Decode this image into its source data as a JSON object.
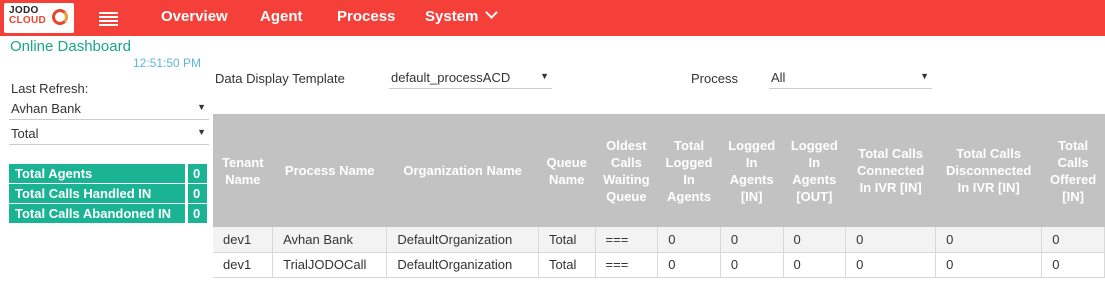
{
  "brand": {
    "line1": "JODO",
    "line2": "CLOUD"
  },
  "nav": {
    "overview": "Overview",
    "agent": "Agent",
    "process": "Process",
    "system": "System"
  },
  "dashboard": {
    "title": "Online Dashboard",
    "clock": "12:51:50 PM",
    "last_refresh_label": "Last Refresh:"
  },
  "left_filters": {
    "tenant": "Avhan Bank",
    "scope": "Total"
  },
  "summary": [
    {
      "label": "Total Agents",
      "value": "0"
    },
    {
      "label": "Total Calls Handled IN",
      "value": "0"
    },
    {
      "label": "Total Calls Abandoned IN",
      "value": "0"
    }
  ],
  "filters": {
    "template_label": "Data Display Template",
    "template_value": "default_processACD",
    "process_label": "Process",
    "process_value": "All"
  },
  "table": {
    "headers": [
      "Tenant Name",
      "Process Name",
      "Organization Name",
      "Queue Name",
      "Oldest Calls Waiting Queue",
      "Total Logged In Agents",
      "Logged In Agents [IN]",
      "Logged In Agents [OUT]",
      "Total Calls Connected In IVR [IN]",
      "Total Calls Disconnected In IVR [IN]",
      "Total Calls Offered [IN]"
    ],
    "rows": [
      [
        "dev1",
        "Avhan Bank",
        "DefaultOrganization",
        "Total",
        "===",
        "0",
        "0",
        "0",
        "0",
        "0",
        "0"
      ],
      [
        "dev1",
        "TrialJODOCall",
        "DefaultOrganization",
        "Total",
        "===",
        "0",
        "0",
        "0",
        "0",
        "0",
        "0"
      ]
    ]
  },
  "colors": {
    "topbar": "#f5403a",
    "accent_green": "#1ab394",
    "title_green": "#1aa68a",
    "clock_blue": "#5fb6d9",
    "header_gray": "#c2c2c2"
  }
}
